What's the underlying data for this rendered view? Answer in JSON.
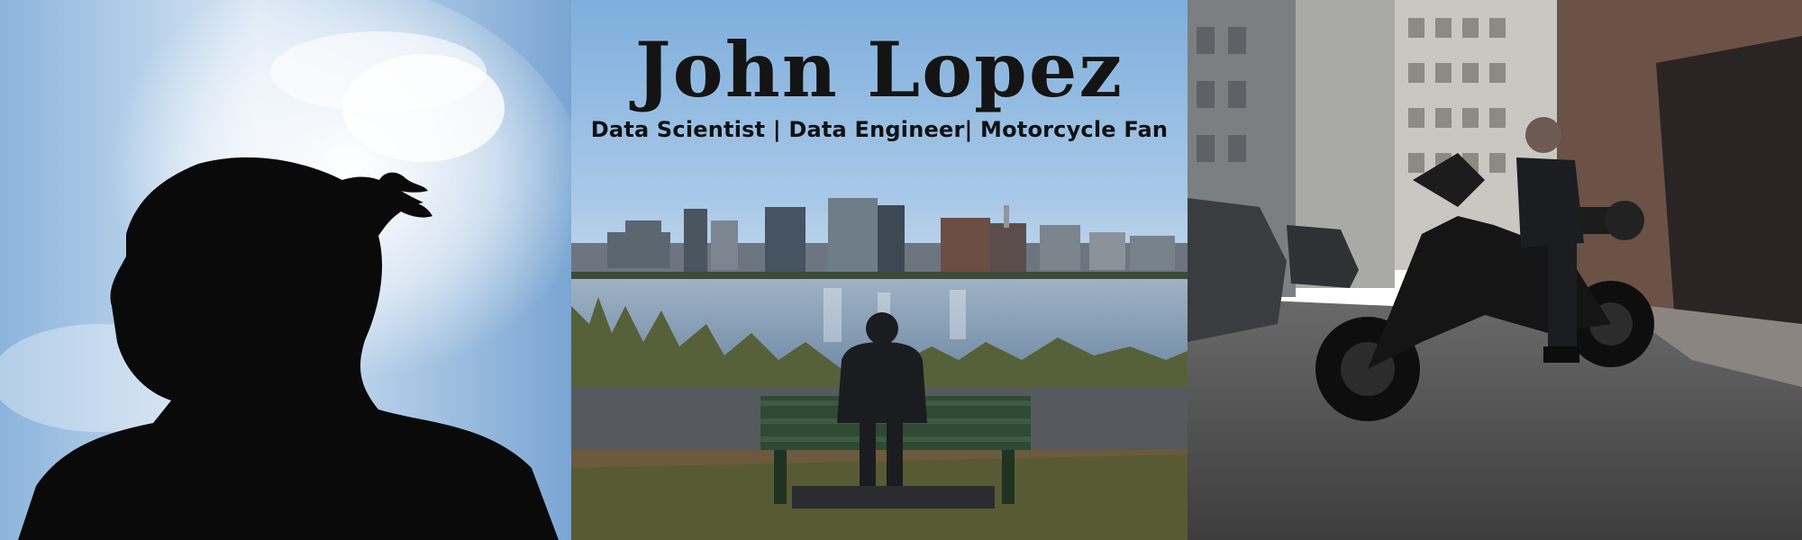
{
  "banner": {
    "name": "John Lopez",
    "tagline": "Data Scientist | Data Engineer| Motorcycle Fan"
  },
  "palette": {
    "sky_left": "#6f9fcc",
    "sky_mid": "#8fbbe6",
    "water": "#8aa1b8",
    "silhouette": "#0b0b0c",
    "brick": "#6b5146",
    "street": "#4b4b4b"
  },
  "panels": [
    {
      "id": "left",
      "subject": "silhouette-portrait"
    },
    {
      "id": "middle",
      "subject": "riverside-city-bench"
    },
    {
      "id": "right",
      "subject": "motorcycle-alley"
    }
  ]
}
